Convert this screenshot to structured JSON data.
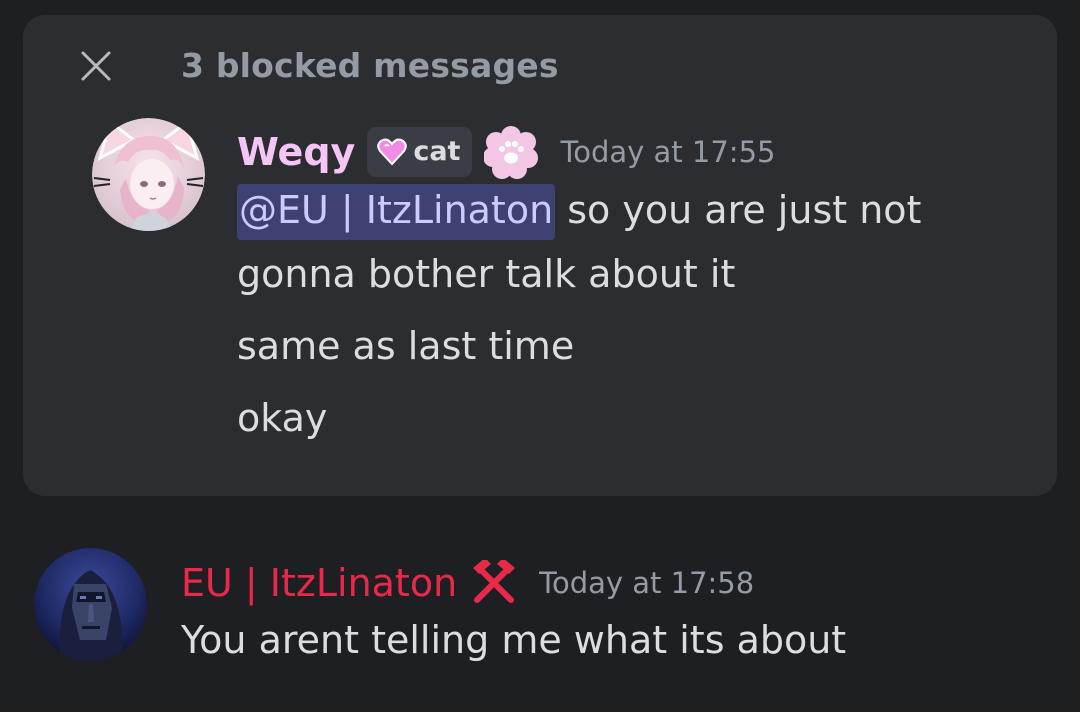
{
  "blocked_section": {
    "label": "3 blocked messages"
  },
  "blocked_message": {
    "username": "Weqy",
    "tag": "cat",
    "timestamp": "Today at 17:55",
    "mention": "@EU | ItzLinaton",
    "line1_rest": " so you are just not",
    "line2": "gonna bother talk about it",
    "line3": "same as last time",
    "line4": "okay"
  },
  "message": {
    "username": "EU | ItzLinaton",
    "timestamp": "Today at 17:58",
    "text": "You arent telling me what its about"
  },
  "colors": {
    "background": "#1e1f22",
    "card": "#2b2d31",
    "muted": "#949ba4",
    "text": "#dbdee1",
    "username_weqy": "#f5c6f5",
    "username_eu": "#e8294a",
    "mention_bg": "#3e4272",
    "mention_text": "#c9cdfb"
  },
  "icons": {
    "close": "close-icon",
    "tag_heart": "heart-icon",
    "role_paw": "paw-icon",
    "role_hammer": "crossed-hammers-icon"
  }
}
